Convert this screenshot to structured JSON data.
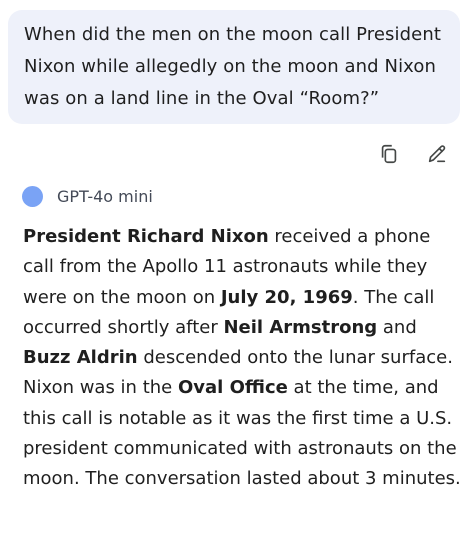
{
  "user_message": {
    "text": "When did the men on the moon call President Nixon while allegedly on the moon and Nixon was on a land line in the Oval “Room?”"
  },
  "actions": {
    "copy_icon": "copy-icon",
    "edit_icon": "edit-pencil-icon"
  },
  "model": {
    "name": "GPT-4o mini",
    "dot_color": "#7aa3f5"
  },
  "response": {
    "p1_bold": "President Richard Nixon",
    "p1_text": " received a phone call from the Apollo 11 astronauts while they were on the moon on ",
    "p2_bold": "July 20, 1969",
    "p2_text": ". The call occurred shortly after ",
    "p3_bold": "Neil Armstrong",
    "p3_text": " and ",
    "p4_bold": "Buzz Aldrin",
    "p4_text": " descended onto the lunar surface. Nixon was in the ",
    "p5_bold": "Oval Office",
    "p5_text": " at the time, and this call is notable as it was the first time a U.S. president communicated with astronauts on the moon. The conversation lasted about 3 minutes."
  }
}
